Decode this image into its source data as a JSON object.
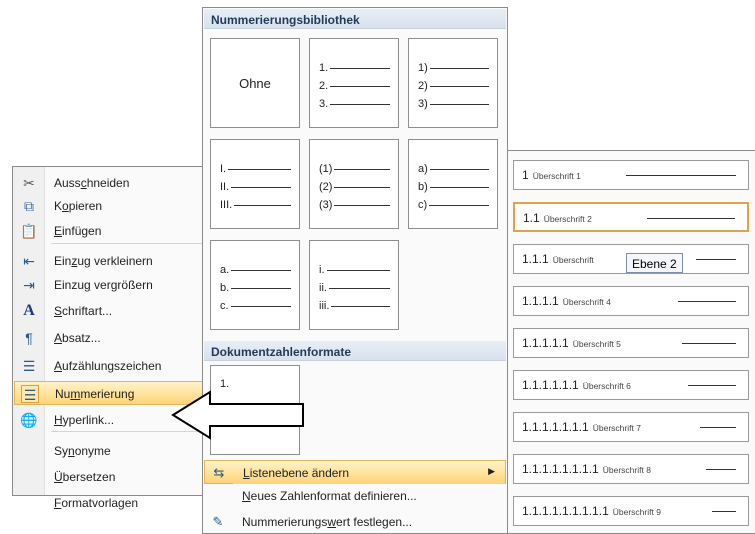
{
  "context_menu": {
    "items": [
      {
        "name": "cut",
        "pre": "Auss",
        "acc": "c",
        "post": "hneiden",
        "icon": "scissors-icon",
        "glyph": "✂",
        "color": "#555555"
      },
      {
        "name": "copy",
        "pre": "K",
        "acc": "o",
        "post": "pieren",
        "icon": "copy-icon",
        "glyph": "⧉",
        "color": "#3a6ea5"
      },
      {
        "name": "paste",
        "pre": "",
        "acc": "E",
        "post": "infügen",
        "icon": "paste-icon",
        "glyph": "📋",
        "color": "#b58a2a"
      },
      {
        "name": "decrease-indent",
        "pre": "Ein",
        "acc": "z",
        "post": "ug verkleinern",
        "icon": "decrease-indent-icon",
        "glyph": "⇤",
        "color": "#2a5a8a"
      },
      {
        "name": "increase-indent",
        "pre": "Einzu",
        "acc": "g",
        "post": " vergrößern",
        "icon": "increase-indent-icon",
        "glyph": "⇥",
        "color": "#2a5a8a"
      },
      {
        "name": "font",
        "pre": "",
        "acc": "S",
        "post": "chriftart...",
        "icon": "font-icon",
        "glyph": "A",
        "color": "#1f3a7a"
      },
      {
        "name": "paragraph",
        "pre": "",
        "acc": "A",
        "post": "bsatz...",
        "icon": "paragraph-icon",
        "glyph": "¶",
        "color": "#2a5a8a"
      },
      {
        "name": "bullets",
        "pre": "",
        "acc": "A",
        "post": "ufzählungszeichen",
        "icon": "bullets-icon",
        "glyph": "☰",
        "color": "#2a5a8a"
      },
      {
        "name": "numbering",
        "pre": "Nu",
        "acc": "m",
        "post": "merierung",
        "icon": "numbering-icon",
        "glyph": "☰",
        "color": "#2a5a8a"
      },
      {
        "name": "hyperlink",
        "pre": "",
        "acc": "H",
        "post": "yperlink...",
        "icon": "hyperlink-icon",
        "glyph": "🌐",
        "color": "#2a7a3a"
      },
      {
        "name": "synonyms",
        "pre": "Sy",
        "acc": "n",
        "post": "onyme",
        "icon": "",
        "glyph": "",
        "color": "#000000"
      },
      {
        "name": "translate",
        "pre": "",
        "acc": "Ü",
        "post": "bersetzen",
        "icon": "",
        "glyph": "",
        "color": "#000000"
      },
      {
        "name": "styles",
        "pre": "",
        "acc": "F",
        "post": "ormatvorlagen",
        "icon": "",
        "glyph": "",
        "color": "#000000"
      }
    ]
  },
  "gallery": {
    "library_header": "Nummerierungsbibliothek",
    "none_label": "Ohne",
    "tiles": [
      [
        "1.",
        "2.",
        "3."
      ],
      [
        "1)",
        "2)",
        "3)"
      ],
      [
        "I.",
        "II.",
        "III."
      ],
      [
        "(1)",
        "(2)",
        "(3)"
      ],
      [
        "a)",
        "b)",
        "c)"
      ],
      [
        "a.",
        "b.",
        "c."
      ],
      [
        "i.",
        "ii.",
        "iii."
      ]
    ],
    "document_header": "Dokumentzahlenformate",
    "document_tile": [
      "1."
    ],
    "menu": [
      {
        "pre": "",
        "acc": "L",
        "post": "istenebene ändern",
        "icon": "list-level-icon",
        "glyph": "⇆"
      },
      {
        "pre": "",
        "acc": "N",
        "post": "eues Zahlenformat definieren...",
        "icon": "",
        "glyph": ""
      },
      {
        "pre": "Nummerierungs",
        "acc": "w",
        "post": "ert festlegen...",
        "icon": "set-value-icon",
        "glyph": "✎"
      }
    ]
  },
  "levels": [
    {
      "number": "1",
      "heading": "Überschrift 1"
    },
    {
      "number": "1.1",
      "heading": "Überschrift 2"
    },
    {
      "number": "1.1.1",
      "heading": "Überschrift"
    },
    {
      "number": "1.1.1.1",
      "heading": "Überschrift 4"
    },
    {
      "number": "1.1.1.1.1",
      "heading": "Überschrift 5"
    },
    {
      "number": "1.1.1.1.1.1",
      "heading": "Überschrift 6"
    },
    {
      "number": "1.1.1.1.1.1.1",
      "heading": "Überschrift 7"
    },
    {
      "number": "1.1.1.1.1.1.1.1",
      "heading": "Überschrift 8"
    },
    {
      "number": "1.1.1.1.1.1.1.1.1",
      "heading": "Überschrift 9"
    }
  ],
  "tooltip": "Ebene 2",
  "colors": {
    "highlight": "#ffd479",
    "border_accent": "#e3a149",
    "header": "#1f3a5a"
  }
}
